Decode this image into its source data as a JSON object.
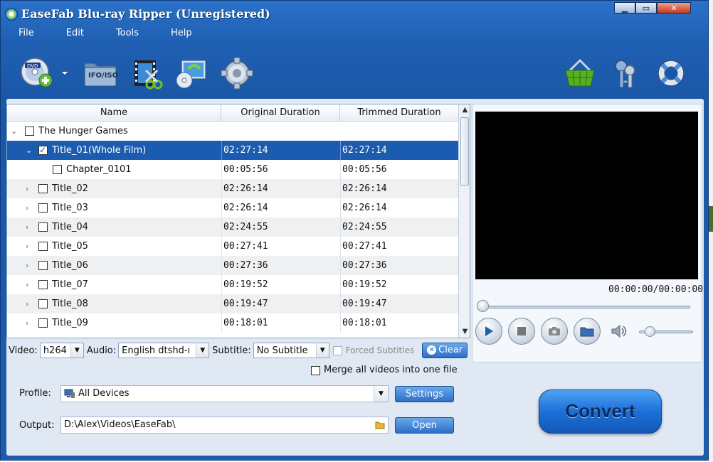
{
  "app": {
    "title": "EaseFab Blu-ray Ripper (Unregistered)",
    "window_buttons": {
      "minimize": "▁",
      "maximize": "▭",
      "close": "✕"
    }
  },
  "menu": [
    "File",
    "Edit",
    "Tools",
    "Help"
  ],
  "toolbar": {
    "load_disc_icon": "dvd-add-icon",
    "ifo_iso_label": "IFO/ISO",
    "edit_icon": "film-edit-icon",
    "merge_icon": "disc-copy-icon",
    "settings_icon": "gear-icon",
    "buy_icon": "basket-icon",
    "register_icon": "keys-icon",
    "help_icon": "lifebuoy-icon"
  },
  "table": {
    "columns": [
      "Name",
      "Original Duration",
      "Trimmed Duration"
    ],
    "group": "The Hunger Games",
    "rows": [
      {
        "name": "Title_01(Whole Film)",
        "original": "02:27:14",
        "trimmed": "02:27:14",
        "checked": true,
        "selected": true,
        "expanded": true,
        "level": 1
      },
      {
        "name": "Chapter_0101",
        "original": "00:05:56",
        "trimmed": "00:05:56",
        "checked": false,
        "level": 2
      },
      {
        "name": "Title_02",
        "original": "02:26:14",
        "trimmed": "02:26:14",
        "checked": false,
        "level": 1
      },
      {
        "name": "Title_03",
        "original": "02:26:14",
        "trimmed": "02:26:14",
        "checked": false,
        "level": 1
      },
      {
        "name": "Title_04",
        "original": "02:24:55",
        "trimmed": "02:24:55",
        "checked": false,
        "level": 1
      },
      {
        "name": "Title_05",
        "original": "00:27:41",
        "trimmed": "00:27:41",
        "checked": false,
        "level": 1
      },
      {
        "name": "Title_06",
        "original": "00:27:36",
        "trimmed": "00:27:36",
        "checked": false,
        "level": 1
      },
      {
        "name": "Title_07",
        "original": "00:19:52",
        "trimmed": "00:19:52",
        "checked": false,
        "level": 1
      },
      {
        "name": "Title_08",
        "original": "00:19:47",
        "trimmed": "00:19:47",
        "checked": false,
        "level": 1
      },
      {
        "name": "Title_09",
        "original": "00:18:01",
        "trimmed": "00:18:01",
        "checked": false,
        "level": 1
      }
    ]
  },
  "options": {
    "video_label": "Video:",
    "video_value": "h264",
    "audio_label": "Audio:",
    "audio_value": "English dtshd-ı",
    "subtitle_label": "Subtitle:",
    "subtitle_value": "No Subtitle",
    "forced_label": "Forced Subtitles",
    "clear_label": "Clear"
  },
  "preview": {
    "time": "00:00:00/00:00:00"
  },
  "merge_label": "Merge all videos into one file",
  "profile": {
    "label": "Profile:",
    "value": "All Devices",
    "settings_label": "Settings"
  },
  "output": {
    "label": "Output:",
    "value": "D:\\Alex\\Videos\\EaseFab\\",
    "open_label": "Open"
  },
  "convert_label": "Convert"
}
